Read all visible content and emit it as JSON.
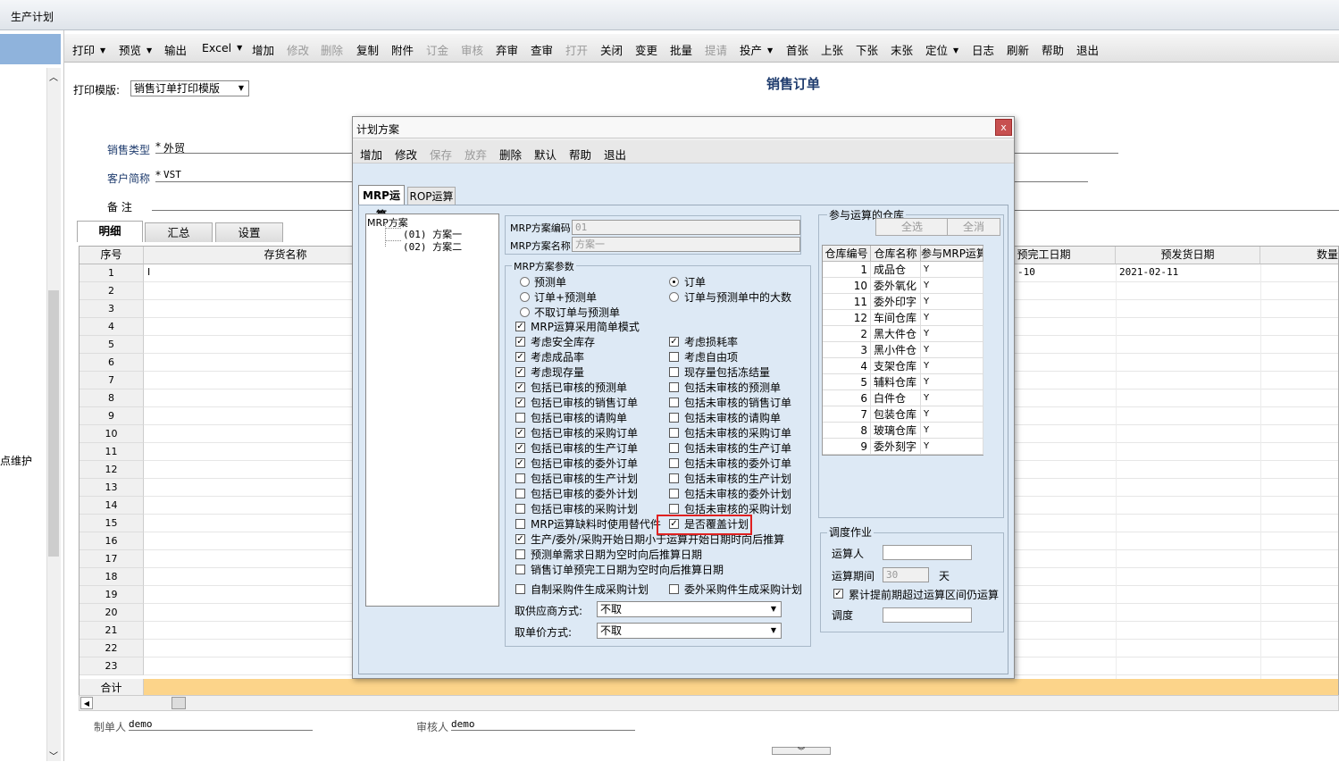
{
  "window": {
    "title": "生产计划"
  },
  "left": {
    "label": "点维护"
  },
  "toolbar": [
    {
      "label": "打印",
      "dd": true
    },
    {
      "label": "预览",
      "dd": true
    },
    {
      "label": "输出"
    },
    {
      "label": "Excel",
      "dd": true
    },
    {
      "label": "增加"
    },
    {
      "label": "修改",
      "disabled": true
    },
    {
      "label": "删除",
      "disabled": true
    },
    {
      "label": "复制"
    },
    {
      "label": "附件"
    },
    {
      "label": "订金",
      "disabled": true
    },
    {
      "label": "审核",
      "disabled": true
    },
    {
      "label": "弃审"
    },
    {
      "label": "查审"
    },
    {
      "label": "打开",
      "disabled": true
    },
    {
      "label": "关闭"
    },
    {
      "label": "变更"
    },
    {
      "label": "批量"
    },
    {
      "label": "提请",
      "disabled": true
    },
    {
      "label": "投产",
      "dd": true
    },
    {
      "label": "首张"
    },
    {
      "label": "上张"
    },
    {
      "label": "下张"
    },
    {
      "label": "末张"
    },
    {
      "label": "定位",
      "dd": true
    },
    {
      "label": "日志"
    },
    {
      "label": "刷新"
    },
    {
      "label": "帮助"
    },
    {
      "label": "退出"
    }
  ],
  "form": {
    "print_template_label": "打印模版:",
    "print_template_value": "销售订单打印模版",
    "title": "销售订单",
    "sales_type_label": "销售类型",
    "sales_type_value": "外贸",
    "customer_label": "客户简称",
    "customer_value": "VST",
    "remark_label": "备    注",
    "tabs": [
      "明细",
      "汇总",
      "设置"
    ],
    "columns": {
      "seq": "序号",
      "name": "存货名称",
      "finish_date": "预完工日期",
      "ship_date": "预发货日期",
      "qty": "数量"
    },
    "row1": {
      "name": "I",
      "finish_date": "-10",
      "ship_date": "2021-02-11"
    },
    "total_label": "合计",
    "maker_label": "制单人",
    "maker_value": "demo",
    "auditor_label": "审核人",
    "auditor_value": "demo"
  },
  "dialog": {
    "title": "计划方案",
    "close": "x",
    "toolbar": [
      {
        "label": "增加"
      },
      {
        "label": "修改"
      },
      {
        "label": "保存",
        "disabled": true
      },
      {
        "label": "放弃",
        "disabled": true
      },
      {
        "label": "删除"
      },
      {
        "label": "默认"
      },
      {
        "label": "帮助"
      },
      {
        "label": "退出"
      }
    ],
    "tabs": [
      "MRP运算",
      "ROP运算"
    ],
    "tree": {
      "root": "MRP方案",
      "items": [
        "(01) 方案一",
        "(02) 方案二"
      ]
    },
    "code_label": "MRP方案编码",
    "code_value": "01",
    "name_label": "MRP方案名称",
    "name_value": "方案一",
    "params_title": "MRP方案参数",
    "radios_left": [
      {
        "label": "预测单",
        "on": false
      },
      {
        "label": "订单+预测单",
        "on": false
      },
      {
        "label": "不取订单与预测单",
        "on": false
      }
    ],
    "radios_right": [
      {
        "label": "订单",
        "on": true
      },
      {
        "label": "订单与预测单中的大数",
        "on": false
      }
    ],
    "checks": [
      [
        {
          "label": "MRP运算采用简单模式",
          "on": true
        },
        null
      ],
      [
        {
          "label": "考虑安全库存",
          "on": true
        },
        {
          "label": "考虑损耗率",
          "on": true
        }
      ],
      [
        {
          "label": "考虑成品率",
          "on": true
        },
        {
          "label": "考虑自由项",
          "on": false
        }
      ],
      [
        {
          "label": "考虑现存量",
          "on": true
        },
        {
          "label": "现存量包括冻结量",
          "on": false
        }
      ],
      [
        {
          "label": "包括已审核的预测单",
          "on": true
        },
        {
          "label": "包括未审核的预测单",
          "on": false
        }
      ],
      [
        {
          "label": "包括已审核的销售订单",
          "on": true
        },
        {
          "label": "包括未审核的销售订单",
          "on": false
        }
      ],
      [
        {
          "label": "包括已审核的请购单",
          "on": false
        },
        {
          "label": "包括未审核的请购单",
          "on": false
        }
      ],
      [
        {
          "label": "包括已审核的采购订单",
          "on": true
        },
        {
          "label": "包括未审核的采购订单",
          "on": false
        }
      ],
      [
        {
          "label": "包括已审核的生产订单",
          "on": true
        },
        {
          "label": "包括未审核的生产订单",
          "on": false
        }
      ],
      [
        {
          "label": "包括已审核的委外订单",
          "on": true
        },
        {
          "label": "包括未审核的委外订单",
          "on": false
        }
      ],
      [
        {
          "label": "包括已审核的生产计划",
          "on": false
        },
        {
          "label": "包括未审核的生产计划",
          "on": false
        }
      ],
      [
        {
          "label": "包括已审核的委外计划",
          "on": false
        },
        {
          "label": "包括未审核的委外计划",
          "on": false
        }
      ],
      [
        {
          "label": "包括已审核的采购计划",
          "on": false
        },
        {
          "label": "包括未审核的采购计划",
          "on": false
        }
      ],
      [
        {
          "label": "MRP运算缺料时使用替代件",
          "on": false
        },
        {
          "label": "是否覆盖计划",
          "on": true
        }
      ]
    ],
    "long_checks": [
      {
        "label": "生产/委外/采购开始日期小于运算开始日期时向后推算",
        "on": true
      },
      {
        "label": "预测单需求日期为空时向后推算日期",
        "on": false
      },
      {
        "label": "销售订单预完工日期为空时向后推算日期",
        "on": false
      }
    ],
    "self_made": {
      "label": "自制采购件生成采购计划",
      "on": false
    },
    "outsourced": {
      "label": "委外采购件生成采购计划",
      "on": false
    },
    "supplier_label": "取供应商方式:",
    "supplier_value": "不取",
    "price_label": "取单价方式:",
    "price_value": "不取",
    "wh_title": "参与运算的仓库",
    "select_all": "全选",
    "clear_all": "全消",
    "wh_cols": [
      "仓库编号",
      "仓库名称",
      "参与MRP运算"
    ],
    "warehouses": [
      {
        "no": "1",
        "name": "成品仓",
        "flag": "Y"
      },
      {
        "no": "10",
        "name": "委外氧化",
        "flag": "Y"
      },
      {
        "no": "11",
        "name": "委外印字",
        "flag": "Y"
      },
      {
        "no": "12",
        "name": "车间仓库",
        "flag": "Y"
      },
      {
        "no": "2",
        "name": "黑大件仓",
        "flag": "Y"
      },
      {
        "no": "3",
        "name": "黑小件仓",
        "flag": "Y"
      },
      {
        "no": "4",
        "name": "支架仓库",
        "flag": "Y"
      },
      {
        "no": "5",
        "name": "辅料仓库",
        "flag": "Y"
      },
      {
        "no": "6",
        "name": "白件仓",
        "flag": "Y"
      },
      {
        "no": "7",
        "name": "包装仓库",
        "flag": "Y"
      },
      {
        "no": "8",
        "name": "玻璃仓库",
        "flag": "Y"
      },
      {
        "no": "9",
        "name": "委外刻字",
        "flag": "Y"
      }
    ],
    "sched_title": "调度作业",
    "operator_label": "运算人",
    "operator_value": "",
    "period_label": "运算期间",
    "period_value": "30",
    "period_unit": "天",
    "accum_label": "累计提前期超过运算区间仍运算",
    "accum_on": true,
    "dispatch_label": "调度",
    "dispatch_value": ""
  }
}
